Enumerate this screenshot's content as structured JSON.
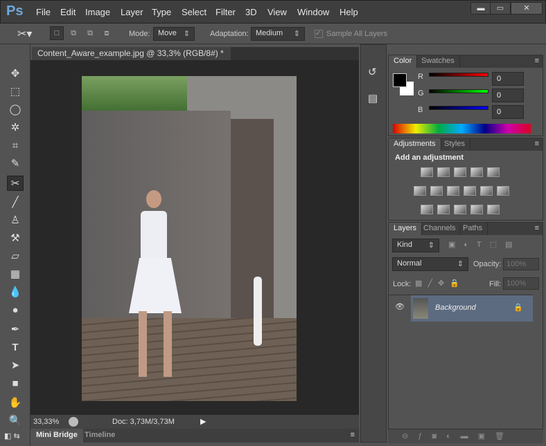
{
  "app": {
    "logo": "Ps"
  },
  "menu": [
    "File",
    "Edit",
    "Image",
    "Layer",
    "Type",
    "Select",
    "Filter",
    "3D",
    "View",
    "Window",
    "Help"
  ],
  "window_controls": {
    "minimize": "▬",
    "maximize": "▭",
    "close": "✕"
  },
  "options": {
    "mode_label": "Mode:",
    "mode_value": "Move",
    "adaptation_label": "Adaptation:",
    "adaptation_value": "Medium",
    "sample_all_layers": "Sample All Layers",
    "sample_checked": true
  },
  "document": {
    "tab_title": "Content_Aware_example.jpg @ 33,3% (RGB/8#) *",
    "close": "×"
  },
  "status": {
    "zoom": "33,33%",
    "doc": "Doc: 3,73M/3,73M"
  },
  "bottom_tabs": [
    "Mini Bridge",
    "Timeline"
  ],
  "color_panel": {
    "tabs": [
      "Color",
      "Swatches"
    ],
    "channels": [
      {
        "label": "R",
        "value": "0",
        "color": "#ff0000"
      },
      {
        "label": "G",
        "value": "0",
        "color": "#00ff00"
      },
      {
        "label": "B",
        "value": "0",
        "color": "#0000ff"
      }
    ],
    "foreground": "#000000",
    "background": "#ffffff"
  },
  "adjustments_panel": {
    "tabs": [
      "Adjustments",
      "Styles"
    ],
    "heading": "Add an adjustment"
  },
  "layers_panel": {
    "tabs": [
      "Layers",
      "Channels",
      "Paths"
    ],
    "filter_kind": "Kind",
    "blend_mode": "Normal",
    "opacity_label": "Opacity:",
    "opacity_value": "100%",
    "lock_label": "Lock:",
    "fill_label": "Fill:",
    "fill_value": "100%",
    "layers": [
      {
        "name": "Background",
        "visible": true,
        "locked": true
      }
    ]
  }
}
